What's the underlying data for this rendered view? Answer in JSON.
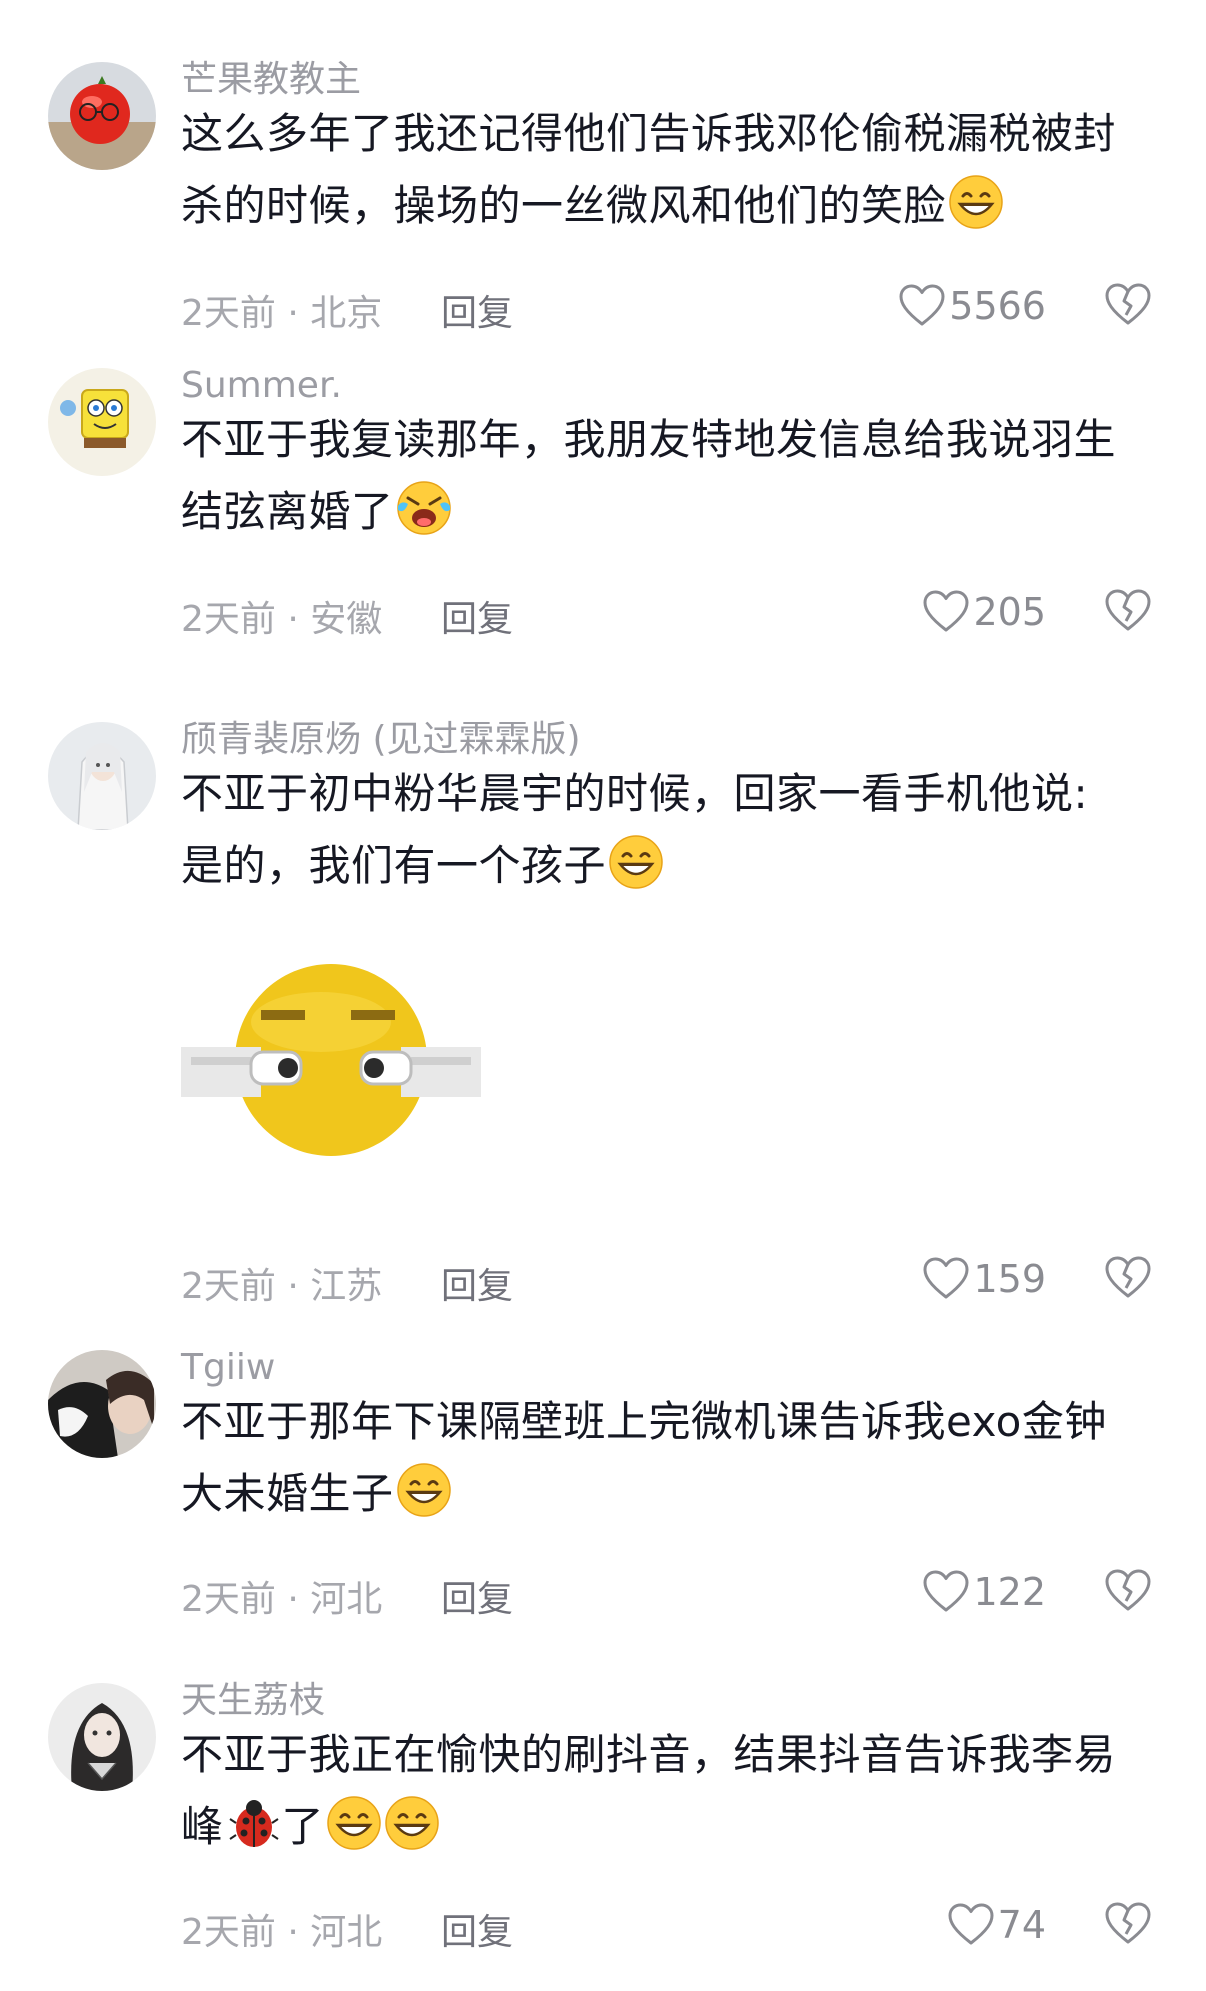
{
  "comments": [
    {
      "username": "芒果教教主",
      "lines": [
        "这么多年了我还记得他们告诉我邓伦偷税漏税被封",
        "杀的时候，操场的一丝微风和他们的笑脸"
      ],
      "meta": "2天前 · 北京",
      "reply": "回复",
      "likes": "5566"
    },
    {
      "username": "Summer.",
      "lines": [
        "不亚于我复读那年，我朋友特地发信息给我说羽生",
        "结弦离婚了"
      ],
      "meta": "2天前 · 安徽",
      "reply": "回复",
      "likes": "205"
    },
    {
      "username": "颀青裴原炀 (见过霖霖版)",
      "lines": [
        "不亚于初中粉华晨宇的时候，回家一看手机他说:",
        "是的，我们有一个孩子"
      ],
      "meta": "2天前 · 江苏",
      "reply": "回复",
      "likes": "159"
    },
    {
      "username": "Tgiiw",
      "lines": [
        "不亚于那年下课隔壁班上完微机课告诉我exo金钟",
        "大未婚生子"
      ],
      "meta": "2天前 · 河北",
      "reply": "回复",
      "likes": "122"
    },
    {
      "username": "天生荔枝",
      "lines": [
        "不亚于我正在愉快的刷抖音，结果抖音告诉我李易",
        "峰"
      ],
      "line2_tail": "了",
      "meta": "2天前 · 河北",
      "reply": "回复",
      "likes": "74"
    }
  ],
  "icons": {
    "like": "heart-outline-icon",
    "dislike": "broken-heart-icon",
    "emoji_grin": "grinning-emoji",
    "emoji_rofl": "rolling-laughing-emoji",
    "emoji_ladybug": "ladybug-emoji"
  },
  "colors": {
    "text": "#161823",
    "meta": "#a6a7ad",
    "username": "#9b9ca3"
  }
}
